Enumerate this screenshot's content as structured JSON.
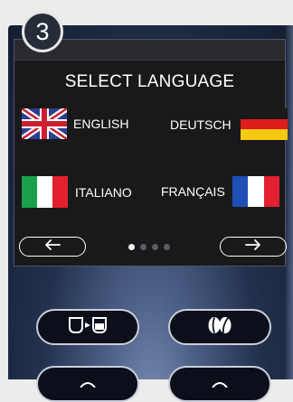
{
  "step_number": "3",
  "screen": {
    "title": "SELECT LANGUAGE",
    "languages": [
      {
        "label": "ENGLISH",
        "flag": "uk-flag-icon"
      },
      {
        "label": "DEUTSCH",
        "flag": "germany-flag-icon"
      },
      {
        "label": "ITALIANO",
        "flag": "italy-flag-icon"
      },
      {
        "label": "FRANÇAIS",
        "flag": "france-flag-icon"
      }
    ],
    "pagination": {
      "total_pages": 4,
      "current_page": 1
    },
    "nav": {
      "prev_icon": "arrow-left-icon",
      "next_icon": "arrow-right-icon"
    }
  },
  "control_buttons": [
    {
      "icon": "cup-to-cup-icon"
    },
    {
      "icon": "coffee-beans-icon"
    },
    {
      "icon": "unknown-icon"
    },
    {
      "icon": "unknown-icon"
    }
  ],
  "colors": {
    "screen_bg": "#19191b",
    "panel_dark": "#141d31",
    "panel_light": "#7f93bb",
    "text": "#ffffff"
  }
}
